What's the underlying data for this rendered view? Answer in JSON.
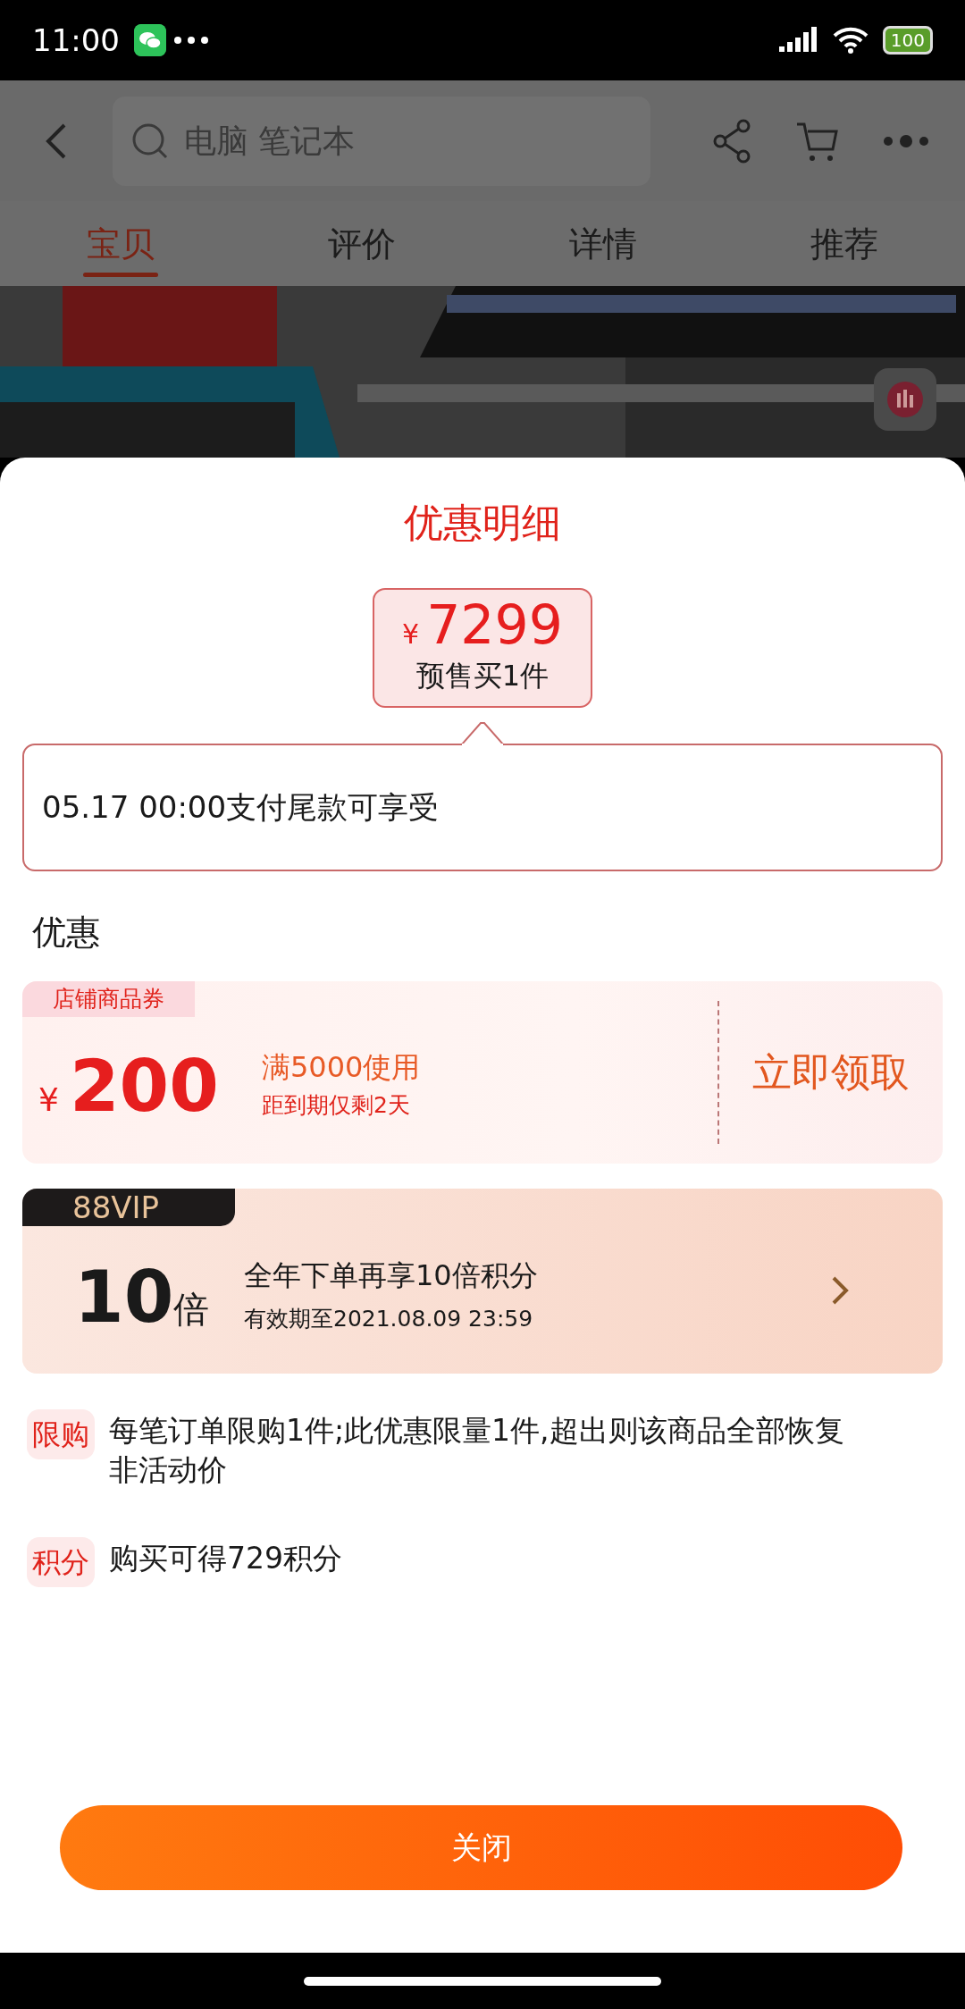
{
  "status_bar": {
    "time": "11:00",
    "battery": "100"
  },
  "app_header": {
    "search": {
      "placeholder": "电脑 笔记本"
    }
  },
  "tabs": [
    {
      "label": "宝贝",
      "selected": true
    },
    {
      "label": "评价",
      "selected": false
    },
    {
      "label": "详情",
      "selected": false
    },
    {
      "label": "推荐",
      "selected": false
    }
  ],
  "sheet": {
    "title": "优惠明细",
    "price": {
      "currency": "¥",
      "amount": "7299",
      "caption": "预售买1件"
    },
    "note": "05.17 00:00支付尾款可享受"
  },
  "discounts": {
    "heading": "优惠",
    "coupon": {
      "tag": "店铺商品券",
      "currency": "¥",
      "amount": "200",
      "condition": "满5000使用",
      "expiry": "距到期仅剩2天",
      "action": "立即领取"
    },
    "vip": {
      "tag": "88VIP",
      "multiplier": "10",
      "unit": "倍",
      "title": "全年下单再享10倍积分",
      "validity": "有效期至2021.08.09 23:59"
    }
  },
  "rules": [
    {
      "tag": "限购",
      "text": "每笔订单限购1件;此优惠限量1件,超出则该商品全部恢复非活动价"
    },
    {
      "tag": "积分",
      "text": "购买可得729积分"
    }
  ],
  "close_button": "关闭"
}
